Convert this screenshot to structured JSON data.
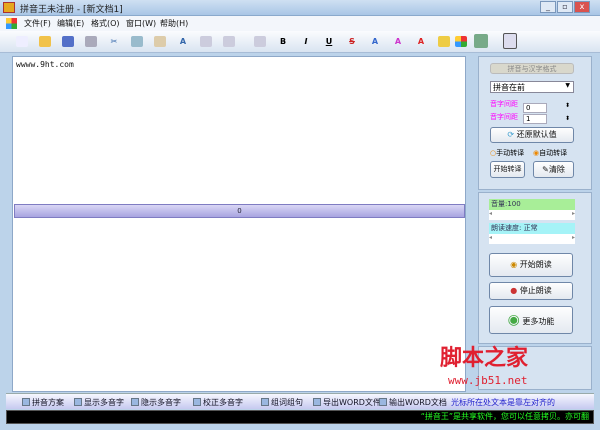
{
  "window": {
    "title": "拼音王未注册  - [新文档1]",
    "min": "_",
    "max": "▫",
    "close": "x"
  },
  "menu": [
    "文件(F)",
    "编辑(E)",
    "格式(O)",
    "窗口(W)",
    "帮助(H)"
  ],
  "toolbar": {
    "bold": "B",
    "italic": "I",
    "underline": "U",
    "strike": "S"
  },
  "editor": {
    "text": "wwww.9ht.com"
  },
  "splitter": {
    "value": "0"
  },
  "format_panel": {
    "header": "拼音与汉字格式",
    "position_select": "拼音在前",
    "char_spacing_label": "音字间距",
    "char_spacing_value": "0",
    "syllable_spacing_label": "音字间距",
    "syllable_spacing_value": "1",
    "restore_button": "还原默认值",
    "manual_label": "手动转译",
    "auto_label": "自动转译",
    "start_button": "开始转译",
    "clear_button": "清除"
  },
  "voice_panel": {
    "volume": "音量:100",
    "speed": "朗读速度: 正常",
    "start_read": "开始朗读",
    "stop_read": "停止朗读",
    "more": "更多功能"
  },
  "bottom_toolbar": [
    "拼音方案",
    "显示多音字",
    "隐示多音字",
    "校正多音字",
    "组词组句",
    "导出WORD文件",
    "输出WORD文档"
  ],
  "bottom_status": "光标所在处文本是靠左对齐的",
  "marquee": "“拼音王”是共享软件，您可以任意拷贝。亦可翻",
  "watermark": {
    "logo": "脚本之家",
    "url": "www.jb51.net"
  }
}
